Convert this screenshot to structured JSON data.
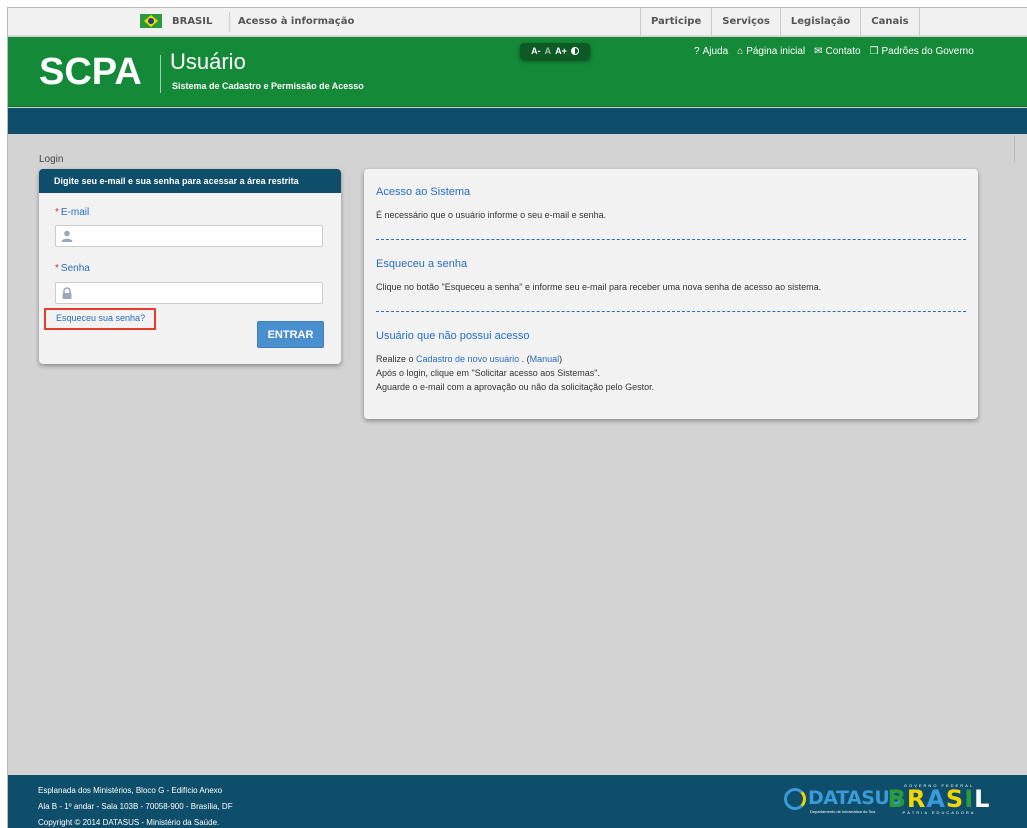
{
  "govbar": {
    "country": "BRASIL",
    "access_info": "Acesso à informação",
    "links": [
      "Participe",
      "Serviços",
      "Legislação",
      "Canais"
    ]
  },
  "header": {
    "logo": "SCPA",
    "title": "Usuário",
    "subtitle": "Sistema de Cadastro e Permissão de Acesso",
    "a11y": {
      "decrease": "A-",
      "normal": "A",
      "increase": "A+"
    },
    "links": {
      "help": "Ajuda",
      "home": "Página inicial",
      "contact": "Contato",
      "standards": "Padrões do Governo"
    }
  },
  "breadcrumb": "Login",
  "login": {
    "heading": "Digite seu e-mail e sua senha para acessar a área restrita",
    "required_mark": "*",
    "email_label": "E-mail",
    "email_value": "",
    "password_label": "Senha",
    "password_value": "",
    "forgot_link": "Esqueceu sua senha?",
    "submit_label": "ENTRAR"
  },
  "info": {
    "s1_title": "Acesso ao Sistema",
    "s1_text": "É necessário que o usuário informe o seu e-mail e senha.",
    "s2_title": "Esqueceu a senha",
    "s2_text": "Clique no botão \"Esqueceu a senha\" e informe seu e-mail para receber uma nova senha de acesso ao sistema.",
    "s3_title": "Usuário que não possui acesso",
    "s3_line1_prefix": "Realize o ",
    "s3_line1_link": "Cadastro de novo usuário",
    "s3_line1_mid": " . (",
    "s3_line1_manual": "Manual",
    "s3_line1_suffix": ")",
    "s3_line2": "Após o login, clique em \"Solicitar acesso aos Sistemas\".",
    "s3_line3": "Aguarde o e-mail com a aprovação ou não da solicitação pelo Gestor."
  },
  "footer": {
    "address1": "Esplanada dos Ministérios, Bloco G - Edifício Anexo",
    "address2": "Ala B - 1º andar - Sala 103B - 70058-900 - Brasília, DF",
    "copyright": "Copyright © 2014 DATASUS - Ministério da Saúde.",
    "datasus": "DATASUS",
    "datasus_sub": "Departamento de Informática do Sus",
    "brasil_top": "GOVERNO FEDERAL",
    "brasil_word": [
      "B",
      "R",
      "A",
      "S",
      "I",
      "L"
    ],
    "brasil_bottom": "PÁTRIA EDUCADORA"
  },
  "colors": {
    "header_green": "#148a38",
    "navy": "#0e4e6a",
    "link_blue": "#2a6ebb",
    "button_blue": "#4a90cf",
    "highlight_red": "#e53b2c"
  }
}
